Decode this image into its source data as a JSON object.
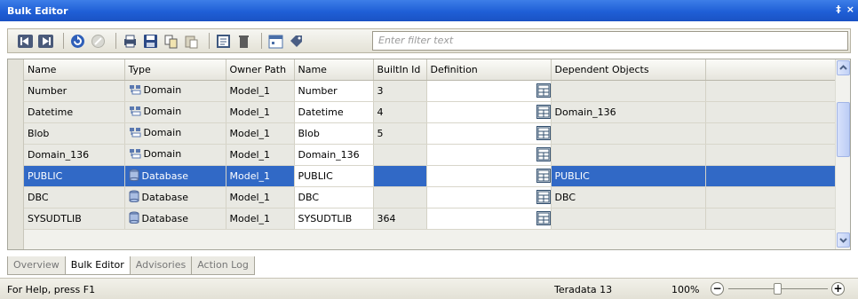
{
  "window": {
    "title": "Bulk Editor",
    "pin_glyph": "‡",
    "close_glyph": "×"
  },
  "toolbar": {
    "icons": [
      "first-record-icon",
      "last-record-icon",
      "refresh-icon",
      "cancel-icon",
      "print-icon",
      "save-icon",
      "copy-icon",
      "paste-icon",
      "properties-icon",
      "delete-icon",
      "calendar-icon",
      "tag-icon"
    ],
    "filter_placeholder": "Enter filter text"
  },
  "grid": {
    "columns": [
      "Name",
      "Type",
      "Owner Path",
      "Name",
      "BuiltIn Id",
      "Definition",
      "Dependent Objects"
    ],
    "rows": [
      {
        "name": "Number",
        "type": "Domain",
        "type_icon": "domain-icon",
        "owner": "Model_1",
        "name2": "Number",
        "builtin": "3",
        "definition": "",
        "dependents": ""
      },
      {
        "name": "Datetime",
        "type": "Domain",
        "type_icon": "domain-icon",
        "owner": "Model_1",
        "name2": "Datetime",
        "builtin": "4",
        "definition": "",
        "dependents": "Domain_136"
      },
      {
        "name": "Blob",
        "type": "Domain",
        "type_icon": "domain-icon",
        "owner": "Model_1",
        "name2": "Blob",
        "builtin": "5",
        "definition": "",
        "dependents": ""
      },
      {
        "name": "Domain_136",
        "type": "Domain",
        "type_icon": "domain-icon",
        "owner": "Model_1",
        "name2": "Domain_136",
        "builtin": "",
        "definition": "",
        "dependents": ""
      },
      {
        "name": "PUBLIC",
        "type": "Database",
        "type_icon": "database-icon",
        "owner": "Model_1",
        "name2": "PUBLIC",
        "builtin": "",
        "definition": "",
        "dependents": "PUBLIC",
        "selected": true
      },
      {
        "name": "DBC",
        "type": "Database",
        "type_icon": "database-icon",
        "owner": "Model_1",
        "name2": "DBC",
        "builtin": "",
        "definition": "",
        "dependents": "DBC"
      },
      {
        "name": "SYSUDTLIB",
        "type": "Database",
        "type_icon": "database-icon",
        "owner": "Model_1",
        "name2": "SYSUDTLIB",
        "builtin": "364",
        "definition": "",
        "dependents": ""
      }
    ],
    "selection_color": "#3169c6"
  },
  "tabs": [
    {
      "label": "Overview",
      "active": false
    },
    {
      "label": "Bulk Editor",
      "active": true
    },
    {
      "label": "Advisories",
      "active": false
    },
    {
      "label": "Action Log",
      "active": false
    }
  ],
  "status": {
    "help": "For Help, press F1",
    "database": "Teradata 13",
    "zoom": "100%",
    "zoom_level_percent": 50
  }
}
